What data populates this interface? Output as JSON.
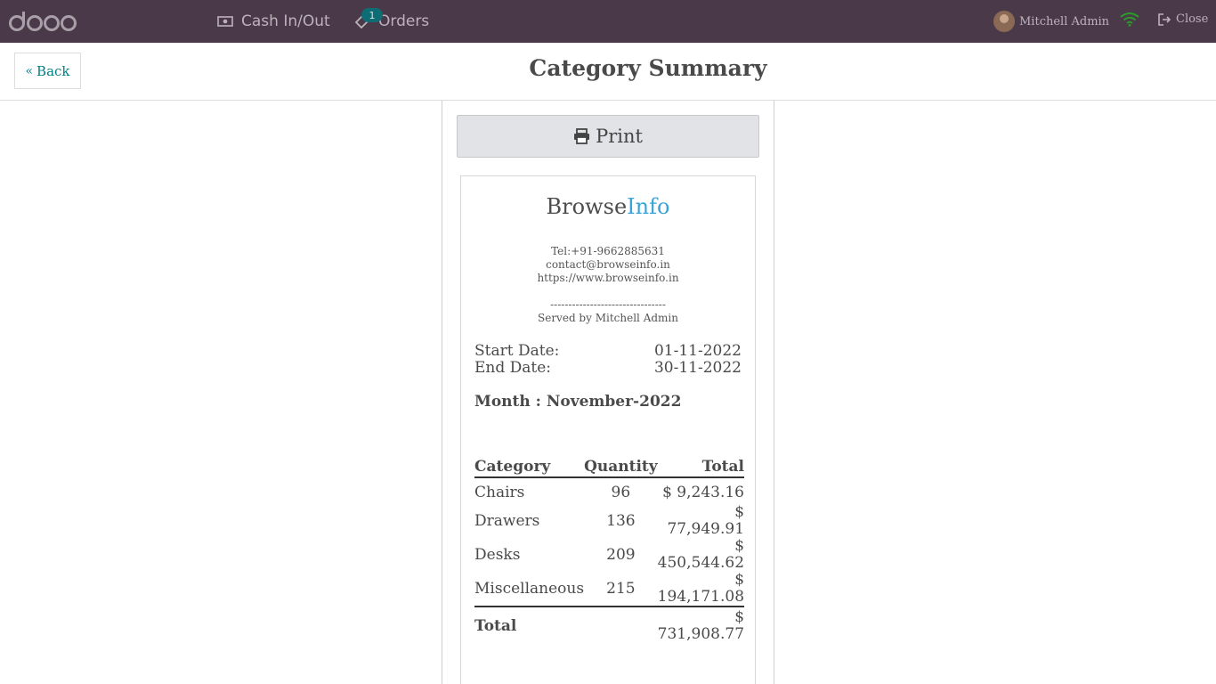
{
  "topbar": {
    "logo_icon": "odoo-logo",
    "nav": [
      {
        "label": "Cash In/Out",
        "icon": "cash-icon"
      },
      {
        "label": "Orders",
        "icon": "tag-icon",
        "badge": "1"
      }
    ],
    "user_name": "Mitchell Admin",
    "close_label": "Close",
    "colors": {
      "bar": "#4a3a49",
      "wifi": "#2c9a2a",
      "badge": "#0e6c74"
    }
  },
  "header": {
    "back_label": "Back",
    "title": "Category Summary"
  },
  "print_label": "Print",
  "receipt": {
    "brand_part1": "Browse",
    "brand_part2": "Info",
    "tel": "Tel:+91-9662885631",
    "email": "contact@browseinfo.in",
    "website": "https://www.browseinfo.in",
    "separator": "--------------------------------",
    "served_by": "Served by Mitchell Admin",
    "start_label": "Start Date:",
    "start_value": "01-11-2022",
    "end_label": "End Date:",
    "end_value": "30-11-2022",
    "month_label": "Month : November-2022",
    "table": {
      "headers": [
        "Category",
        "Quantity",
        "Total"
      ],
      "rows": [
        {
          "category": "Chairs",
          "quantity": "96",
          "total": "$ 9,243.16"
        },
        {
          "category": "Drawers",
          "quantity": "136",
          "total_currency": "$",
          "total_amount": "77,949.91"
        },
        {
          "category": "Desks",
          "quantity": "209",
          "total_currency": "$",
          "total_amount": "450,544.62"
        },
        {
          "category": "Miscellaneous",
          "quantity": "215",
          "total_currency": "$",
          "total_amount": "194,171.08"
        }
      ],
      "total_label": "Total",
      "total_currency": "$",
      "total_amount": "731,908.77"
    }
  }
}
